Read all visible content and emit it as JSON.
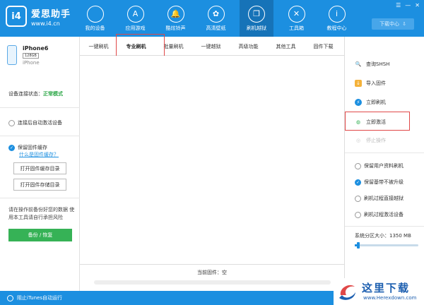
{
  "app": {
    "logo_mark": "i4",
    "logo_title": "爱思助手",
    "logo_url": "www.i4.cn"
  },
  "nav": [
    {
      "label": "我的设备",
      "icon": "apple-icon",
      "glyph": ""
    },
    {
      "label": "应用游戏",
      "icon": "app-store-icon",
      "glyph": "A"
    },
    {
      "label": "酷炫铃声",
      "icon": "bell-icon",
      "glyph": "🔔"
    },
    {
      "label": "高清壁纸",
      "icon": "flower-icon",
      "glyph": "✿"
    },
    {
      "label": "刷机越狱",
      "icon": "box-icon",
      "glyph": "❒"
    },
    {
      "label": "工具箱",
      "icon": "tools-icon",
      "glyph": "✕"
    },
    {
      "label": "教程中心",
      "icon": "info-icon",
      "glyph": "i"
    }
  ],
  "window": {
    "download_label": "下载中心",
    "controls": [
      "☰",
      "—",
      "✕"
    ]
  },
  "device": {
    "name": "iPhone6",
    "capacity": "128GB",
    "type": "iPhone"
  },
  "connection": {
    "label": "设备连接状态：",
    "status": "正常模式"
  },
  "left": {
    "auto_activate": "连接后自动激活设备",
    "keep_cache": "保留固件缓存",
    "what_is_cache": "什么是固件缓存？",
    "open_cache_dir": "打开固件缓存目录",
    "open_storage_dir": "打开固件存储目录",
    "note": "请在操作前备份好您的数据 使用本工具请自行承担风险",
    "backup_button": "备份 / 恢复"
  },
  "tabs": [
    "一键刷机",
    "专业刷机",
    "批量刷机",
    "一键越狱",
    "高级功能",
    "其他工具",
    "固件下载"
  ],
  "active_tab_index": 1,
  "right": {
    "actions": [
      {
        "label": "查询SHSH",
        "icon": "search-icon",
        "glyph": "🔍"
      },
      {
        "label": "导入固件",
        "icon": "import-icon",
        "glyph": "↓"
      },
      {
        "label": "立即刷机",
        "icon": "flash-icon",
        "glyph": "⚡"
      },
      {
        "label": "立即激活",
        "icon": "globe-icon",
        "glyph": "◍"
      },
      {
        "label": "停止操作",
        "icon": "stop-icon",
        "glyph": "◎"
      }
    ],
    "options": [
      {
        "label": "保留用户资料刷机",
        "checked": false
      },
      {
        "label": "保留基带不被升级",
        "checked": true
      },
      {
        "label": "刷机过程直接越狱",
        "checked": false
      },
      {
        "label": "刷机过程激活设备",
        "checked": false
      }
    ],
    "partition": {
      "label": "系统分区大小：",
      "value": "1350 MB",
      "level": 0.03
    }
  },
  "firmware": {
    "label": "当前固件：空"
  },
  "bottom": {
    "itunes": "阻止iTunes自动运行"
  },
  "watermark": {
    "text": "这里下载",
    "url": "www.Herexdown.com"
  },
  "colors": {
    "primary": "#1c8fe0",
    "green": "#36b256",
    "highlight": "#e04848"
  }
}
